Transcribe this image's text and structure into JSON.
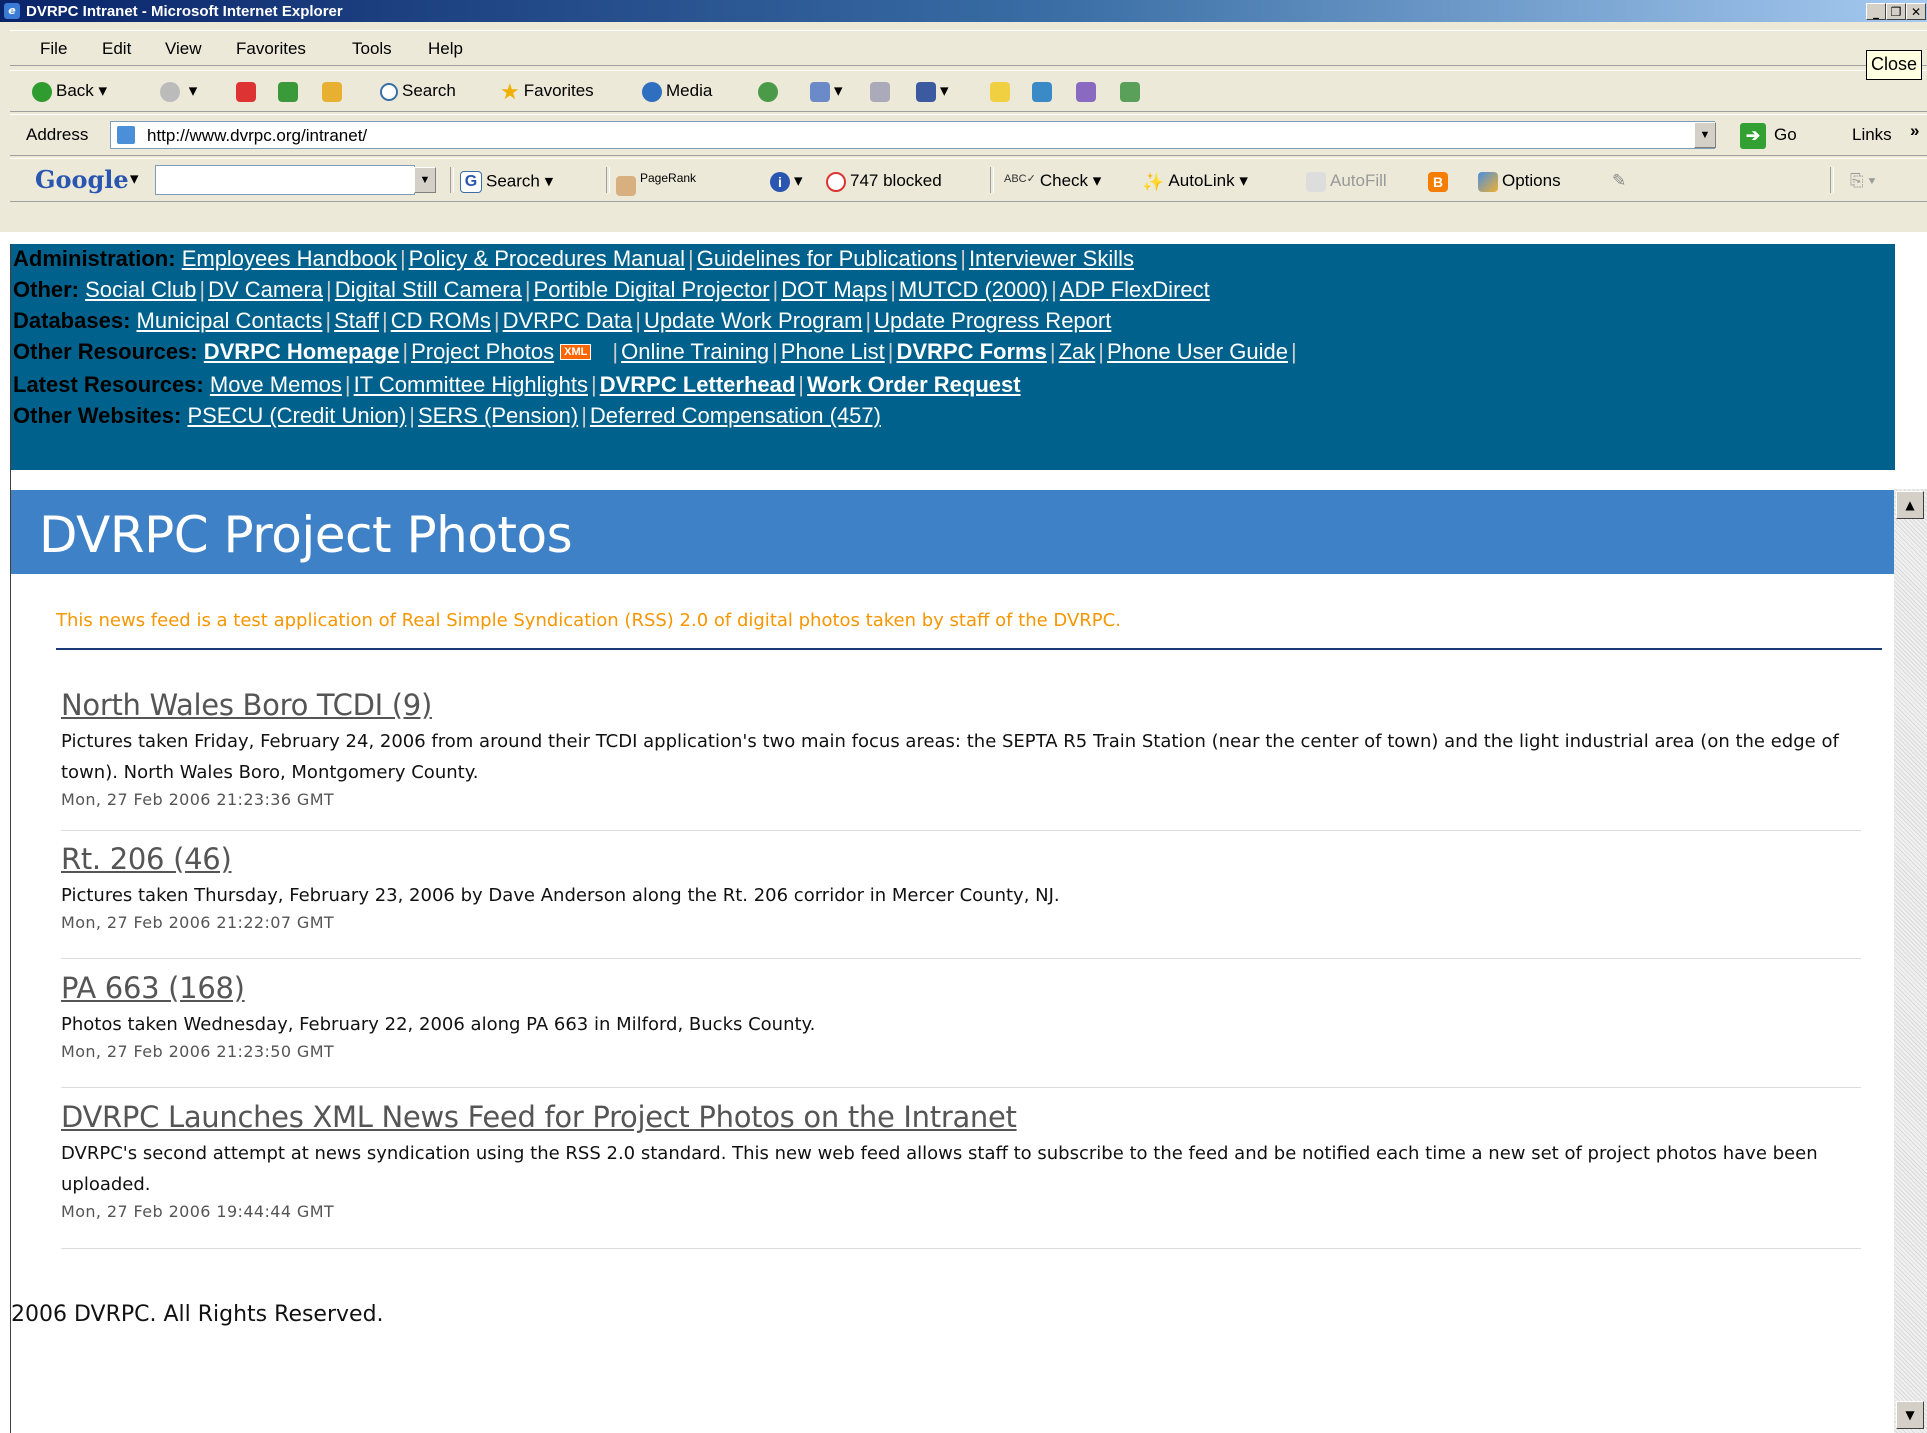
{
  "window": {
    "title": "DVRPC Intranet - Microsoft Internet Explorer",
    "tooltip": "Close"
  },
  "menu": [
    "File",
    "Edit",
    "View",
    "Favorites",
    "Tools",
    "Help"
  ],
  "toolbar": {
    "back": "Back",
    "search": "Search",
    "favorites": "Favorites",
    "media": "Media"
  },
  "address": {
    "label": "Address",
    "url": "http://www.dvrpc.org/intranet/",
    "go": "Go",
    "links": "Links"
  },
  "google_bar": {
    "logo": "Google",
    "search": "Search",
    "pagerank": "PageRank",
    "blocked": "747 blocked",
    "check": "Check",
    "autolink": "AutoLink",
    "autofill": "AutoFill",
    "options": "Options"
  },
  "nav": {
    "administration_label": "Administration:",
    "administration": [
      "Employees Handbook",
      "Policy & Procedures Manual",
      "Guidelines for Publications",
      "Interviewer Skills"
    ],
    "other_label": "Other:",
    "other": [
      "Social Club",
      "DV Camera",
      "Digital Still Camera",
      "Portible Digital Projector",
      "DOT Maps",
      "MUTCD (2000)",
      "ADP FlexDirect"
    ],
    "databases_label": "Databases:",
    "databases": [
      "Municipal Contacts",
      "Staff",
      "CD ROMs",
      "DVRPC Data",
      "Update Work Program",
      "Update Progress Report"
    ],
    "other_resources_label": "Other Resources:",
    "other_resources": [
      "DVRPC Homepage",
      "Project Photos",
      "Online Training",
      "Phone List",
      "DVRPC Forms",
      "Zak",
      "Phone User Guide"
    ],
    "xml_badge": "XML",
    "latest_label": "Latest Resources:",
    "latest": [
      "Move Memos",
      "IT Committee Highlights",
      "DVRPC Letterhead",
      "Work Order Request"
    ],
    "websites_label": "Other Websites:",
    "websites": [
      "PSECU (Credit Union)",
      "SERS (Pension)",
      "Deferred Compensation (457)"
    ]
  },
  "page": {
    "title": "DVRPC Project Photos",
    "description": "This news feed is a test application of Real Simple Syndication (RSS) 2.0 of digital photos taken by staff of the DVRPC.",
    "items": [
      {
        "title": "North Wales Boro TCDI (9)",
        "desc": "Pictures taken Friday, February 24, 2006 from around their TCDI application's two main focus areas: the SEPTA R5 Train Station (near the center of town) and the light industrial area (on the edge of town). North Wales Boro, Montgomery County.",
        "date": "Mon, 27 Feb 2006 21:23:36 GMT"
      },
      {
        "title": "Rt. 206 (46)",
        "desc": "Pictures taken Thursday, February 23, 2006 by Dave Anderson along the Rt. 206 corridor in Mercer County, NJ.",
        "date": "Mon, 27 Feb 2006 21:22:07 GMT"
      },
      {
        "title": "PA 663 (168)",
        "desc": "Photos taken Wednesday, February 22, 2006 along PA 663 in Milford, Bucks County.",
        "date": "Mon, 27 Feb 2006 21:23:50 GMT"
      },
      {
        "title": "DVRPC Launches XML News Feed for Project Photos on the Intranet",
        "desc": "DVRPC's second attempt at news syndication using the RSS 2.0 standard. This new web feed allows staff to subscribe to the feed and be notified each time a new set of project photos have been uploaded.",
        "date": "Mon, 27 Feb 2006 19:44:44 GMT"
      }
    ],
    "footer": "2006 DVRPC. All Rights Reserved."
  }
}
